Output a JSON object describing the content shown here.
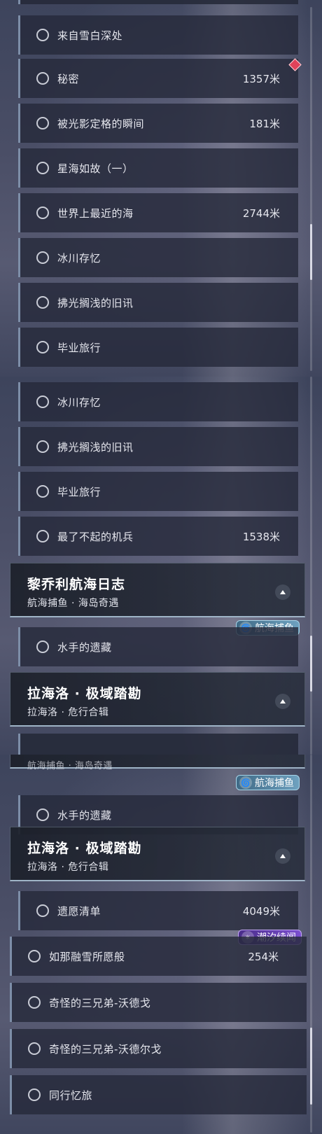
{
  "panels": [
    {
      "id": "panel-1",
      "rows": [
        {
          "title": "来自雪白深处",
          "distance": ""
        },
        {
          "title": "秘密",
          "distance": "1357米"
        },
        {
          "title": "被光影定格的瞬间",
          "distance": "181米"
        },
        {
          "title": "星海如故（一）",
          "distance": ""
        },
        {
          "title": "世界上最近的海",
          "distance": "2744米"
        },
        {
          "title": "冰川存忆",
          "distance": ""
        },
        {
          "title": "拂光搁浅的旧讯",
          "distance": ""
        },
        {
          "title": "毕业旅行",
          "distance": ""
        }
      ]
    },
    {
      "id": "panel-2",
      "rows": [
        {
          "title": "冰川存忆",
          "distance": ""
        },
        {
          "title": "拂光搁浅的旧讯",
          "distance": ""
        },
        {
          "title": "毕业旅行",
          "distance": ""
        },
        {
          "title": "最了不起的机兵",
          "distance": "1538米"
        }
      ],
      "header_1": {
        "title": "黎乔利航海日志",
        "subtitle": "航海捕鱼 · 海岛奇遇"
      },
      "row_after_header_1": {
        "title": "水手的遗藏",
        "distance": ""
      },
      "header_2": {
        "title": "拉海洛 · 极域踏勘",
        "subtitle": "拉海洛 · 危行合辑"
      },
      "badge": "航海捕鱼"
    },
    {
      "id": "panel-3",
      "cut_text": "航海捕鱼 · 海岛奇遇",
      "badge_fishing": "航海捕鱼",
      "row_top": {
        "title": "水手的遗藏",
        "distance": ""
      },
      "header": {
        "title": "拉海洛 · 极域踏勘",
        "subtitle": "拉海洛 · 危行合辑"
      },
      "row_list": {
        "title": "遗愿清单",
        "distance": "4049米"
      },
      "badge_tide": "潮汐续闻",
      "wide_rows": [
        {
          "title": "如那融雪所愿般",
          "distance": "254米"
        },
        {
          "title": "奇怪的三兄弟-沃德戈",
          "distance": ""
        },
        {
          "title": "奇怪的三兄弟-沃德尔戈",
          "distance": ""
        },
        {
          "title": "同行忆旅",
          "distance": ""
        }
      ]
    }
  ],
  "icons": {
    "quest_status": "empty-circle-icon",
    "collapse": "chevron-up-icon",
    "tracked_marker": "red-diamond-marker-icon",
    "fishing_badge_icon": "spiral-icon",
    "tide_badge_icon": "swirl-icon"
  },
  "colors": {
    "row_bg": "#262a3a",
    "row_accent": "#7d8ea8",
    "fishing_badge": "#6ea1bf",
    "tide_badge": "#7b4fd0",
    "marker": "#e0435a"
  }
}
